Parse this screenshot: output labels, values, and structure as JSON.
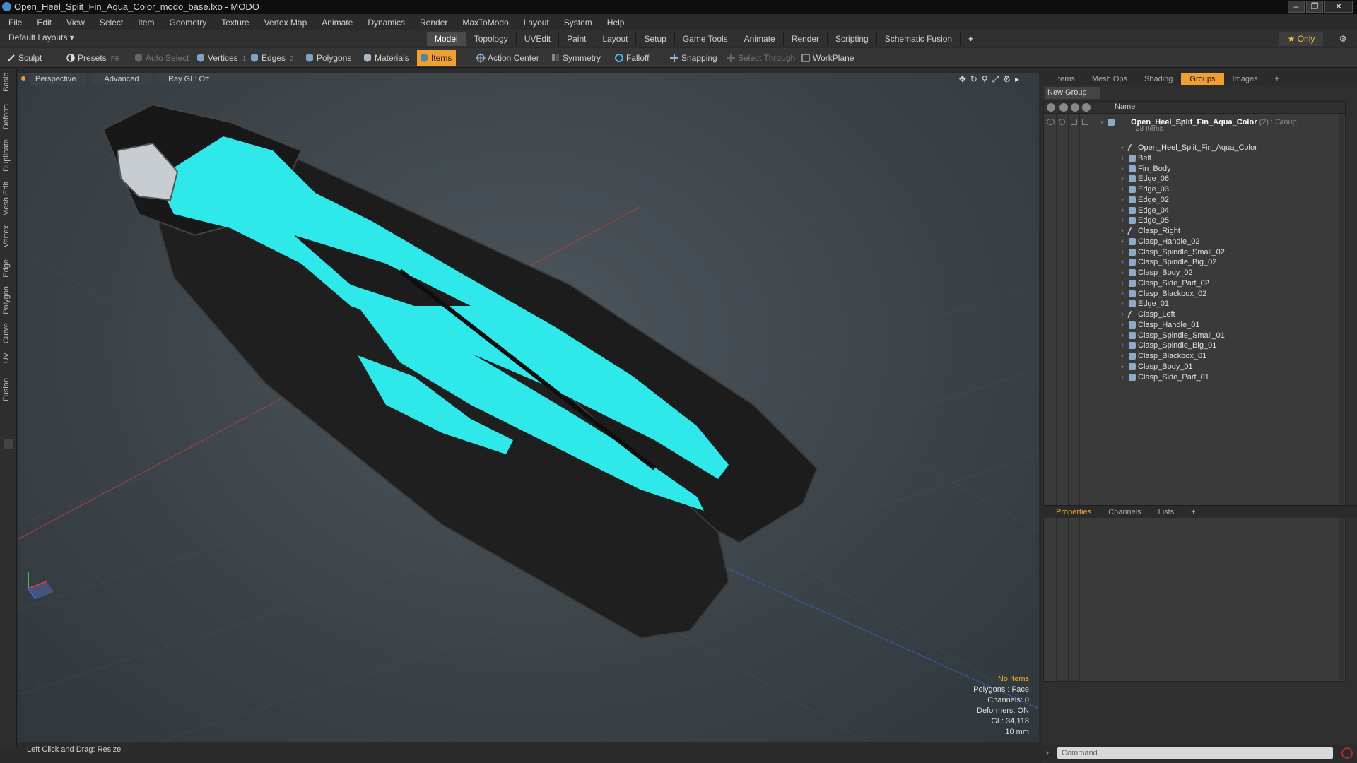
{
  "window": {
    "title": "Open_Heel_Split_Fin_Aqua_Color_modo_base.lxo - MODO",
    "controls": [
      "–",
      "❐",
      "✕"
    ]
  },
  "menubar": [
    "File",
    "Edit",
    "View",
    "Select",
    "Item",
    "Geometry",
    "Texture",
    "Vertex Map",
    "Animate",
    "Dynamics",
    "Render",
    "MaxToModo",
    "Layout",
    "System",
    "Help"
  ],
  "layoutrow": {
    "layouts_label": "Default Layouts ▾",
    "tabs": [
      "Model",
      "Topology",
      "UVEdit",
      "Paint",
      "Layout",
      "Setup",
      "Game Tools",
      "Animate",
      "Render",
      "Scripting",
      "Schematic Fusion"
    ],
    "active_tab": "Model",
    "add": "+",
    "only_label": "★ Only"
  },
  "toolbar": {
    "sculpt": "Sculpt",
    "presets": "Presets",
    "presets_key": "F6",
    "auto_select": "Auto Select",
    "vertices": "Vertices",
    "vertices_key": "1",
    "edges": "Edges",
    "edges_key": "2",
    "polygons": "Polygons",
    "materials": "Materials",
    "items": "Items",
    "action_center": "Action Center",
    "symmetry": "Symmetry",
    "falloff": "Falloff",
    "snapping": "Snapping",
    "select_through": "Select Through",
    "workplane": "WorkPlane"
  },
  "left_tabs": [
    "Basic",
    "Deform",
    "Duplicate",
    "Mesh Edit",
    "Vertex",
    "Edge",
    "Polygon",
    "Curve",
    "UV",
    "Fusion"
  ],
  "viewport": {
    "view": "Perspective",
    "shading": "Advanced",
    "raygl": "Ray GL: Off",
    "info": {
      "selection": "No Items",
      "polygons": "Polygons : Face",
      "channels": "Channels: 0",
      "deformers": "Deformers: ON",
      "gl": "GL: 34,118",
      "unit": "10 mm"
    },
    "model_colors": {
      "accent": "#2ee8ea",
      "body": "#1c1c1c"
    }
  },
  "statusbar": {
    "hint": "Left Click and Drag:  Resize"
  },
  "right_panel": {
    "tabs": [
      "Items",
      "Mesh Ops",
      "Shading",
      "Groups",
      "Images",
      "+"
    ],
    "active_tab": "Groups",
    "new_group": "New Group",
    "name_header": "Name",
    "group": {
      "name": "Open_Heel_Split_Fin_Aqua_Color",
      "suffix": "(2) : Group",
      "count": "23 Items"
    },
    "items": [
      {
        "label": "Open_Heel_Split_Fin_Aqua_Color",
        "kind": "locator"
      },
      {
        "label": "Belt",
        "kind": "mesh"
      },
      {
        "label": "Fin_Body",
        "kind": "mesh"
      },
      {
        "label": "Edge_06",
        "kind": "mesh"
      },
      {
        "label": "Edge_03",
        "kind": "mesh"
      },
      {
        "label": "Edge_02",
        "kind": "mesh"
      },
      {
        "label": "Edge_04",
        "kind": "mesh"
      },
      {
        "label": "Edge_05",
        "kind": "mesh"
      },
      {
        "label": "Clasp_Right",
        "kind": "locator"
      },
      {
        "label": "Clasp_Handle_02",
        "kind": "mesh"
      },
      {
        "label": "Clasp_Spindle_Small_02",
        "kind": "mesh"
      },
      {
        "label": "Clasp_Spindle_Big_02",
        "kind": "mesh"
      },
      {
        "label": "Clasp_Body_02",
        "kind": "mesh"
      },
      {
        "label": "Clasp_Side_Part_02",
        "kind": "mesh"
      },
      {
        "label": "Clasp_Blackbox_02",
        "kind": "mesh"
      },
      {
        "label": "Edge_01",
        "kind": "mesh"
      },
      {
        "label": "Clasp_Left",
        "kind": "locator"
      },
      {
        "label": "Clasp_Handle_01",
        "kind": "mesh"
      },
      {
        "label": "Clasp_Spindle_Small_01",
        "kind": "mesh"
      },
      {
        "label": "Clasp_Spindle_Big_01",
        "kind": "mesh"
      },
      {
        "label": "Clasp_Blackbox_01",
        "kind": "mesh"
      },
      {
        "label": "Clasp_Body_01",
        "kind": "mesh"
      },
      {
        "label": "Clasp_Side_Part_01",
        "kind": "mesh"
      }
    ],
    "properties_tabs": [
      "Properties",
      "Channels",
      "Lists",
      "+"
    ],
    "properties_active": "Properties",
    "command_placeholder": "Command"
  }
}
